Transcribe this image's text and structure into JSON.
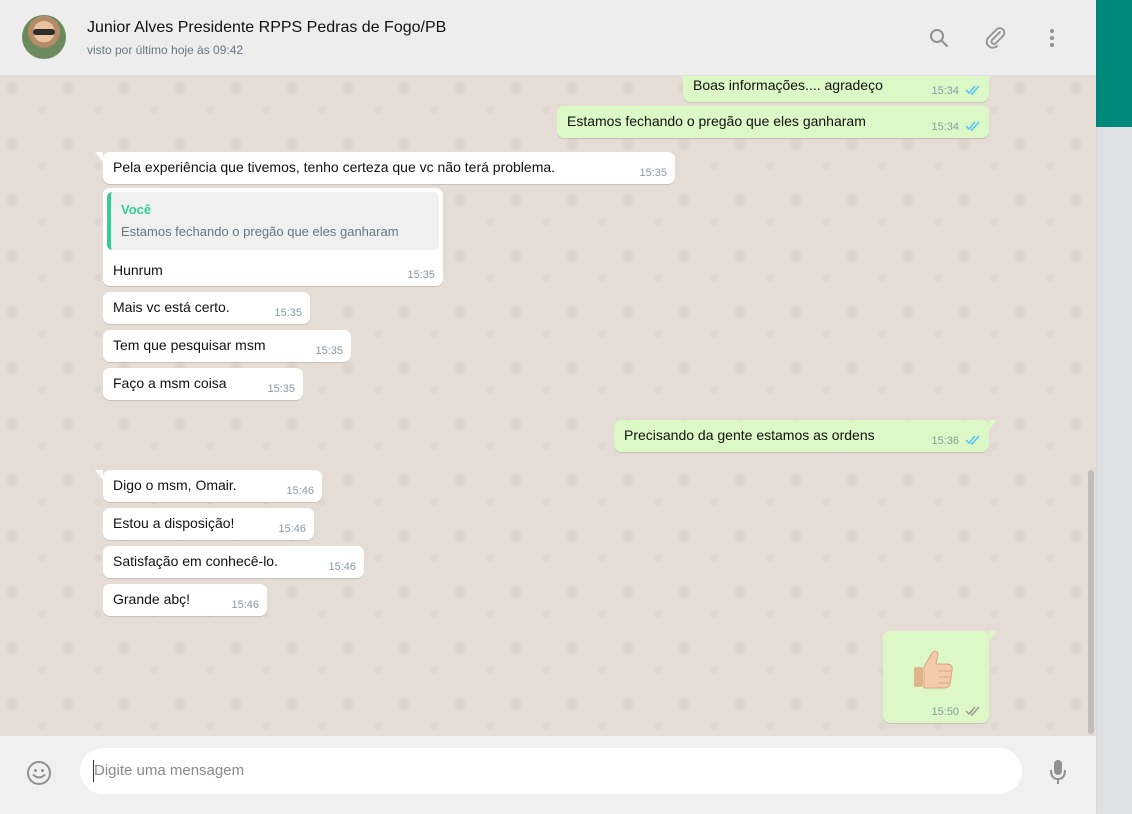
{
  "contact": {
    "name": "Junior Alves Presidente RPPS Pedras de Fogo/PB",
    "status": "visto por último hoje às 09:42"
  },
  "header_icons": [
    "search-icon",
    "paperclip-icon",
    "menu-dots-icon"
  ],
  "messages": [
    {
      "dir": "out",
      "text": "Boas informações.... agradeço",
      "time": "15:34",
      "ticks": "read"
    },
    {
      "dir": "out",
      "text": "Estamos fechando o pregão que eles ganharam",
      "time": "15:34",
      "ticks": "read"
    },
    {
      "dir": "in",
      "text": "Pela experiência que tivemos, tenho certeza que vc não terá problema.",
      "time": "15:35"
    },
    {
      "dir": "in",
      "quote_author": "Você",
      "quote_text": "Estamos fechando o pregão que eles ganharam",
      "text": "Hunrum",
      "time": "15:35"
    },
    {
      "dir": "in",
      "text": "Mais vc está certo.",
      "time": "15:35"
    },
    {
      "dir": "in",
      "text": "Tem que pesquisar msm",
      "time": "15:35"
    },
    {
      "dir": "in",
      "text": "Faço a msm coisa",
      "time": "15:35"
    },
    {
      "dir": "out",
      "text": "Precisando da gente estamos as ordens",
      "time": "15:36",
      "ticks": "read"
    },
    {
      "dir": "in",
      "text": "Digo o msm, Omair.",
      "time": "15:46"
    },
    {
      "dir": "in",
      "text": "Estou a disposição!",
      "time": "15:46"
    },
    {
      "dir": "in",
      "text": "Satisfação em conhecê-lo.",
      "time": "15:46"
    },
    {
      "dir": "in",
      "text": "Grande abç!",
      "time": "15:46"
    },
    {
      "dir": "out",
      "emoji": "thumbs-up",
      "time": "15:50",
      "ticks": "delivered"
    }
  ],
  "composer": {
    "placeholder": "Digite uma mensagem",
    "emoji_icon": "smiley-icon",
    "mic_icon": "microphone-icon"
  },
  "colors": {
    "header_band": "#00897b",
    "outgoing": "#dcf8c6",
    "incoming": "#ffffff",
    "chat_bg": "#e5ddd5",
    "read_tick": "#4fc3f7",
    "quote_accent": "#35cd96"
  }
}
